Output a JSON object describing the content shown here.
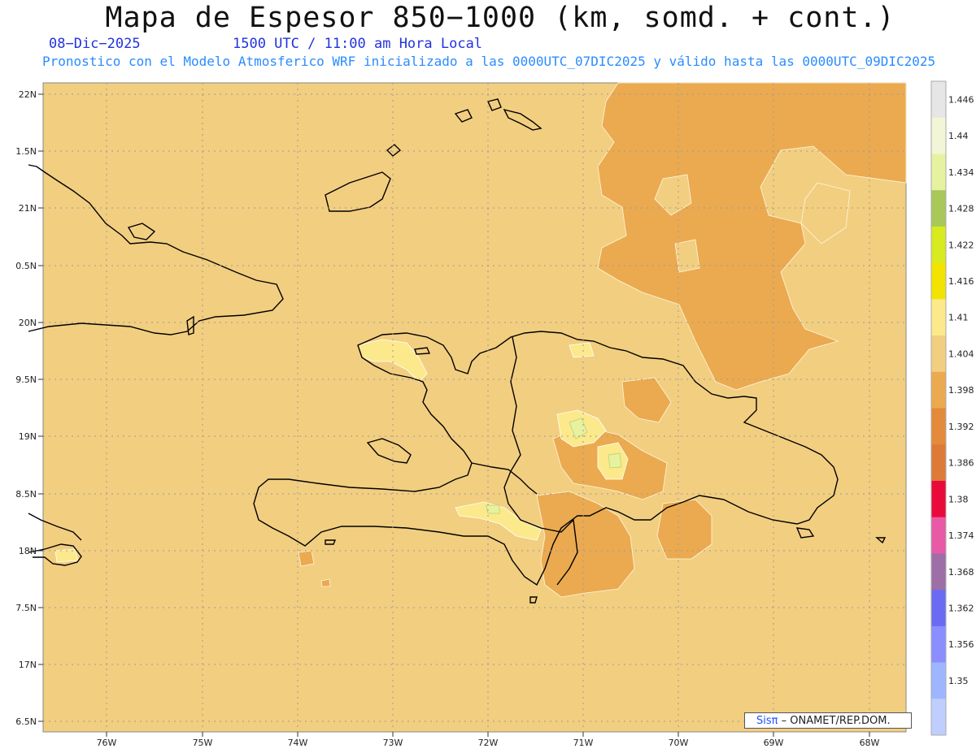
{
  "title": "Mapa de Espesor 850−1000 (km, somd. + cont.)",
  "date_label": "08−Dic−2025",
  "time_label": "1500 UTC / 11:00 am Hora Local",
  "subtitle": "Pronostico con el Modelo Atmosferico WRF inicializado a las 0000UTC_07DIC2025 y válido hasta las  0000UTC_09DIC2025",
  "lat_labels": [
    "22N",
    "1.5N",
    "21N",
    "0.5N",
    "20N",
    "9.5N",
    "19N",
    "8.5N",
    "18N",
    "7.5N",
    "17N",
    "6.5N"
  ],
  "lon_labels": [
    "76W",
    "75W",
    "74W",
    "73W",
    "72W",
    "71W",
    "70W",
    "69W",
    "68W"
  ],
  "colorbar": {
    "levels": [
      "1.446",
      "1.44",
      "1.434",
      "1.428",
      "1.422",
      "1.416",
      "1.41",
      "1.404",
      "1.398",
      "1.392",
      "1.386",
      "1.38",
      "1.374",
      "1.368",
      "1.362",
      "1.356",
      "1.35"
    ],
    "colors": [
      "#e6e6e6",
      "#f2f5d6",
      "#e6f2a0",
      "#a8c85a",
      "#d8ea20",
      "#f2e400",
      "#fbe98c",
      "#f2ce80",
      "#ebaa50",
      "#e38a3c",
      "#dd7a38",
      "#ea0a3a",
      "#e85aa6",
      "#9e6ea6",
      "#6a6af2",
      "#8a8eff",
      "#9eb6ff",
      "#c0ceff"
    ]
  },
  "fill_colors": {
    "base": "#f2ce80",
    "lower": "#ebaa50",
    "high": "#fbe98c",
    "higher": "#e6f2a0",
    "coast": "#000000"
  },
  "credit": {
    "sis": "Sisπ",
    "text": "– ONAMET/REP.DOM."
  },
  "chart_data": {
    "type": "heatmap",
    "title": "Mapa de Espesor 850−1000 (km, somd. + cont.)",
    "xlabel": "",
    "ylabel": "",
    "xlim": [
      -76.65,
      -67.6
    ],
    "ylim": [
      16.4,
      22.1
    ],
    "field": "Espesor 850-1000 hPa (km)",
    "color_levels": [
      1.35,
      1.356,
      1.362,
      1.368,
      1.374,
      1.38,
      1.386,
      1.392,
      1.398,
      1.404,
      1.41,
      1.416,
      1.422,
      1.428,
      1.434,
      1.44,
      1.446
    ],
    "background_range": [
      1.404,
      1.41
    ],
    "grid": true
  }
}
